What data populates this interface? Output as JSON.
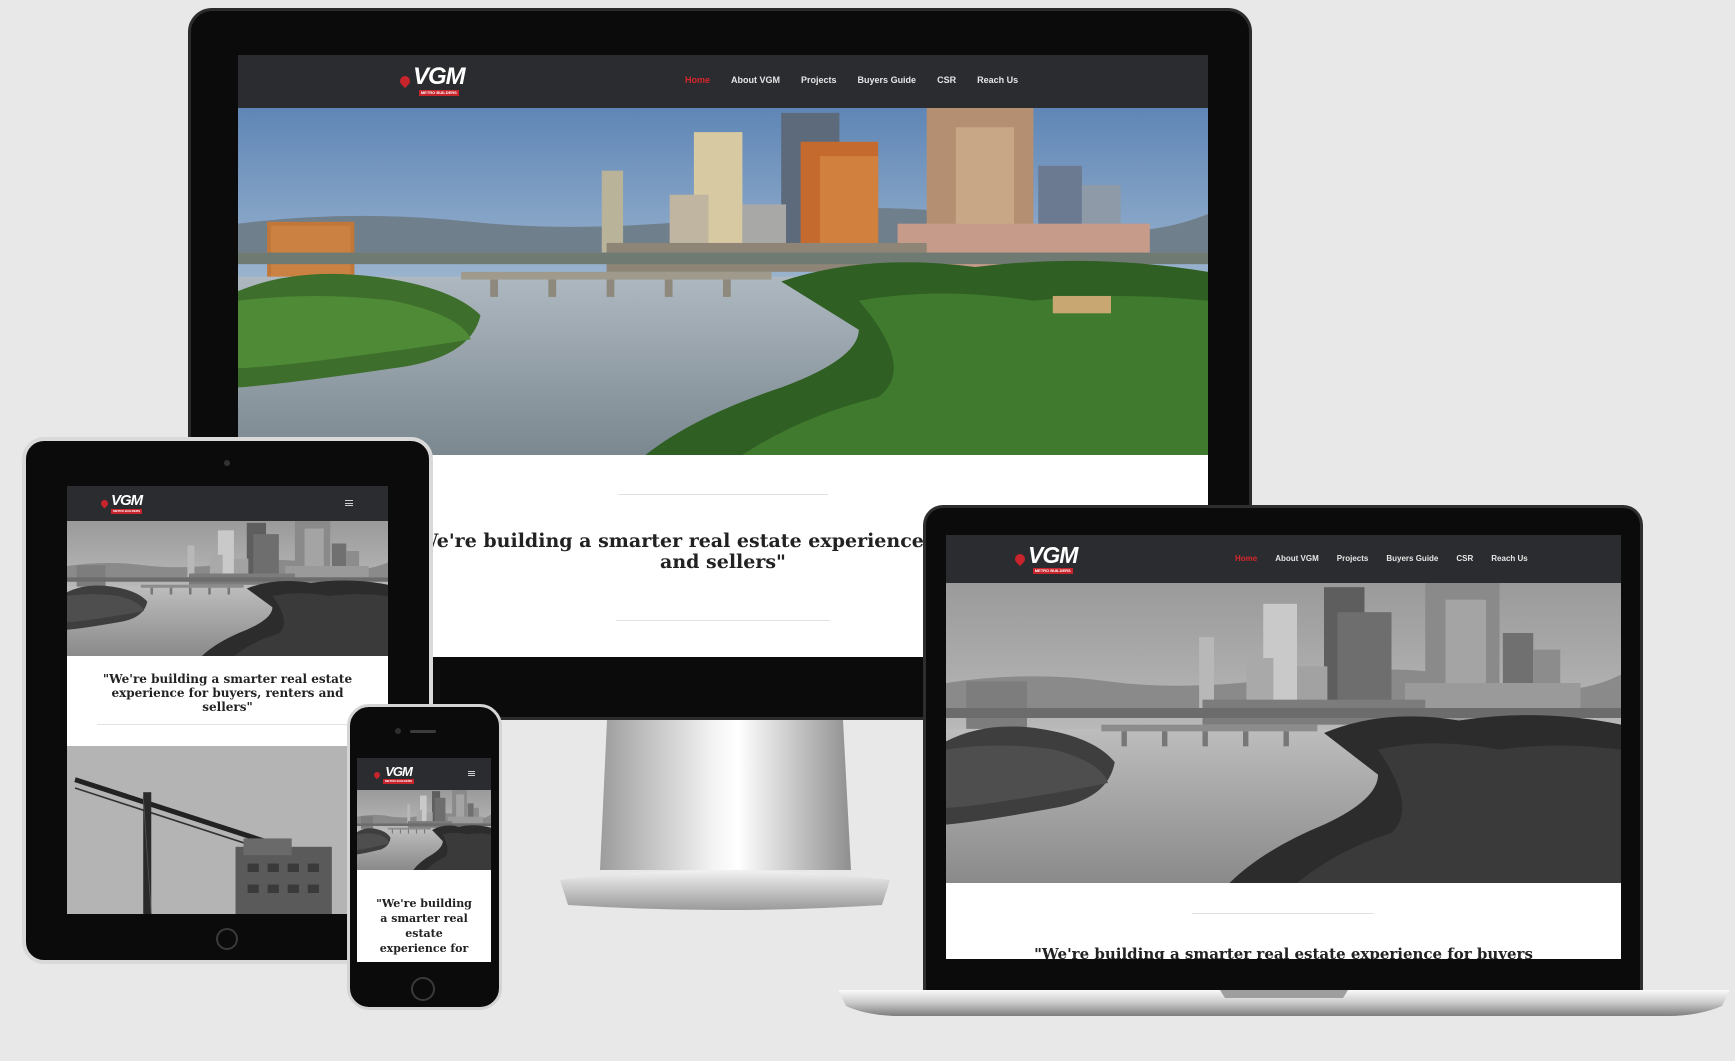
{
  "site": {
    "logo_text": "VGM",
    "logo_subtext": "METRO BUILDERS",
    "nav": [
      {
        "label": "Home",
        "active": true
      },
      {
        "label": "About VGM",
        "active": false
      },
      {
        "label": "Projects",
        "active": false
      },
      {
        "label": "Buyers Guide",
        "active": false
      },
      {
        "label": "CSR",
        "active": false
      },
      {
        "label": "Reach Us",
        "active": false
      }
    ],
    "accent_color": "#d9262d",
    "header_color": "#2a2c2f"
  },
  "desktop": {
    "quote": "\"We're building a smarter real estate experience for buyers\nand sellers\""
  },
  "tablet": {
    "quote": "\"We're building a smarter real estate\nexperience for buyers, renters and\nsellers\""
  },
  "phone": {
    "quote": "\"We're building\na smarter real\nestate\nexperience for"
  },
  "laptop": {
    "quote": "\"We're building a smarter real estate experience for buyers"
  },
  "icons": {
    "menu": "hamburger-icon",
    "home_button": "home-button-icon",
    "logo_pin": "map-pin-icon"
  }
}
